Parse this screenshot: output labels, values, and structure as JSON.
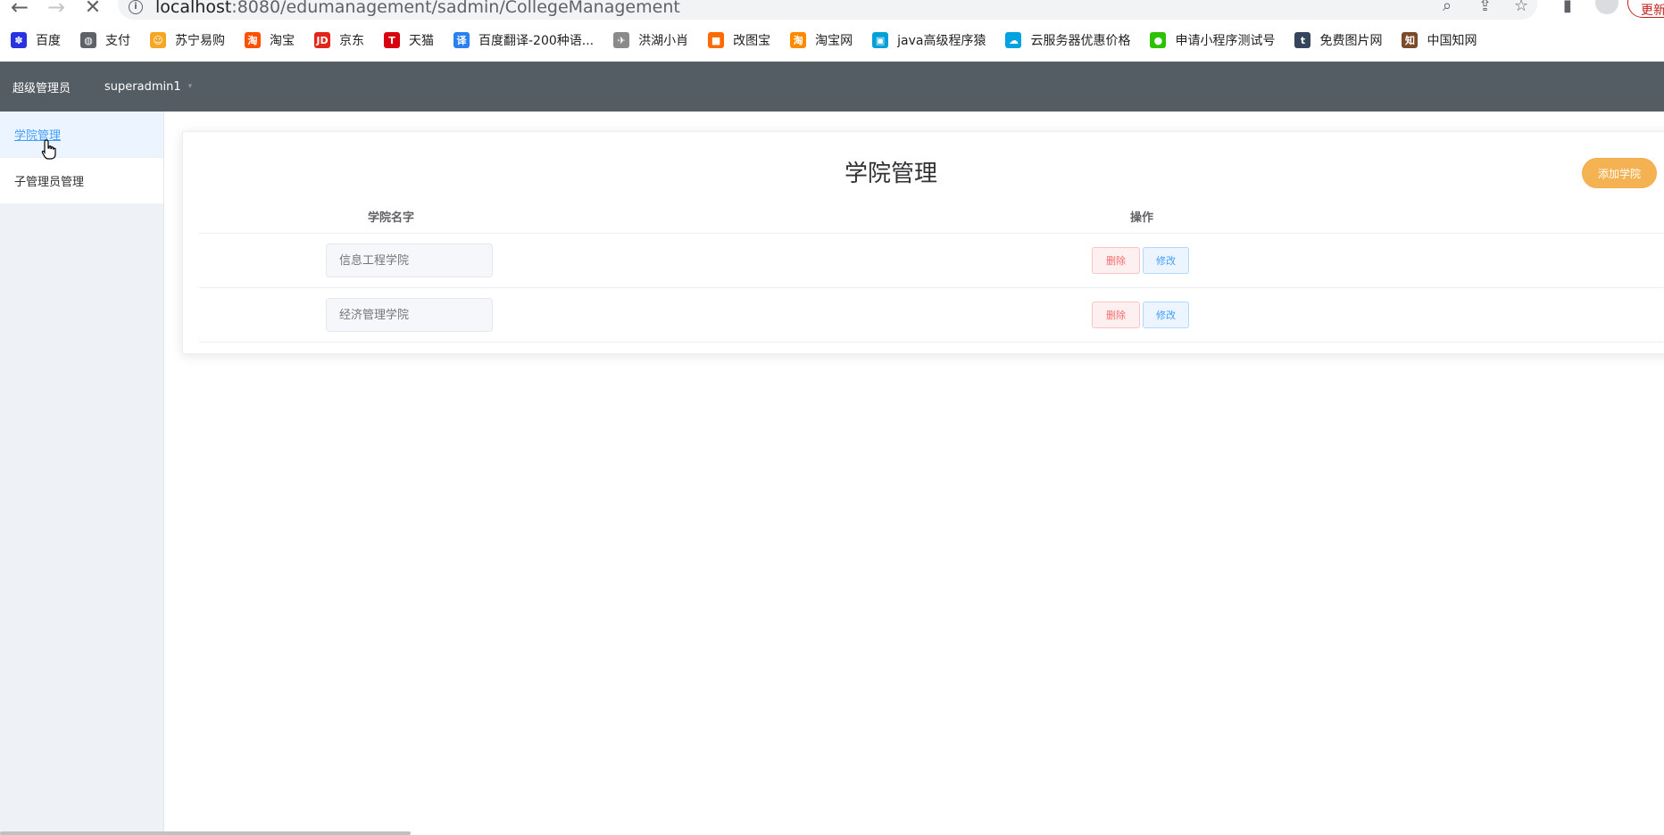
{
  "browser": {
    "url_host": "localhost",
    "url_rest": ":8080/edumanagement/sadmin/CollegeManagement",
    "update_label": "更新",
    "bookmarks": [
      {
        "label": "百度",
        "icon": "baidu-icon",
        "color": "#2932e1",
        "glyph": "✽"
      },
      {
        "label": "支付",
        "icon": "globe-icon",
        "color": "#5f6368",
        "glyph": "◍"
      },
      {
        "label": "苏宁易购",
        "icon": "suning-icon",
        "color": "#f5a623",
        "glyph": "☺"
      },
      {
        "label": "淘宝",
        "icon": "taobao-icon",
        "color": "#ff5000",
        "glyph": "淘"
      },
      {
        "label": "京东",
        "icon": "jd-icon",
        "color": "#e1251b",
        "glyph": "JD"
      },
      {
        "label": "天猫",
        "icon": "tmall-icon",
        "color": "#d8000f",
        "glyph": "T"
      },
      {
        "label": "百度翻译-200种语...",
        "icon": "translate-icon",
        "color": "#2b80f0",
        "glyph": "译"
      },
      {
        "label": "洪湖小肖",
        "icon": "bird-icon",
        "color": "#8a8a8a",
        "glyph": "✈"
      },
      {
        "label": "改图宝",
        "icon": "gaitubao-icon",
        "color": "#ff6a00",
        "glyph": "■"
      },
      {
        "label": "淘宝网",
        "icon": "taobao-icon",
        "color": "#ff8a00",
        "glyph": "淘"
      },
      {
        "label": "java高级程序猿",
        "icon": "bilibili-icon",
        "color": "#00a1d6",
        "glyph": "▣"
      },
      {
        "label": "云服务器优惠价格",
        "icon": "cloud-icon",
        "color": "#00a3e0",
        "glyph": "☁"
      },
      {
        "label": "申请小程序测试号",
        "icon": "wechat-icon",
        "color": "#2dc100",
        "glyph": "●"
      },
      {
        "label": "免费图片网",
        "icon": "tumblr-icon",
        "color": "#35465c",
        "glyph": "t"
      },
      {
        "label": "中国知网",
        "icon": "cnki-icon",
        "color": "#7a4a2a",
        "glyph": "知"
      }
    ]
  },
  "header": {
    "role": "超级管理员",
    "username": "superadmin1"
  },
  "sidebar": {
    "items": [
      {
        "label": "学院管理",
        "active": true
      },
      {
        "label": "子管理员管理",
        "active": false
      }
    ]
  },
  "main": {
    "title": "学院管理",
    "add_button": "添加学院",
    "columns": {
      "name": "学院名字",
      "actions": "操作"
    },
    "rows": [
      {
        "name_placeholder": "信息工程学院",
        "delete": "删除",
        "edit": "修改"
      },
      {
        "name_placeholder": "经济管理学院",
        "delete": "删除",
        "edit": "修改"
      }
    ]
  }
}
